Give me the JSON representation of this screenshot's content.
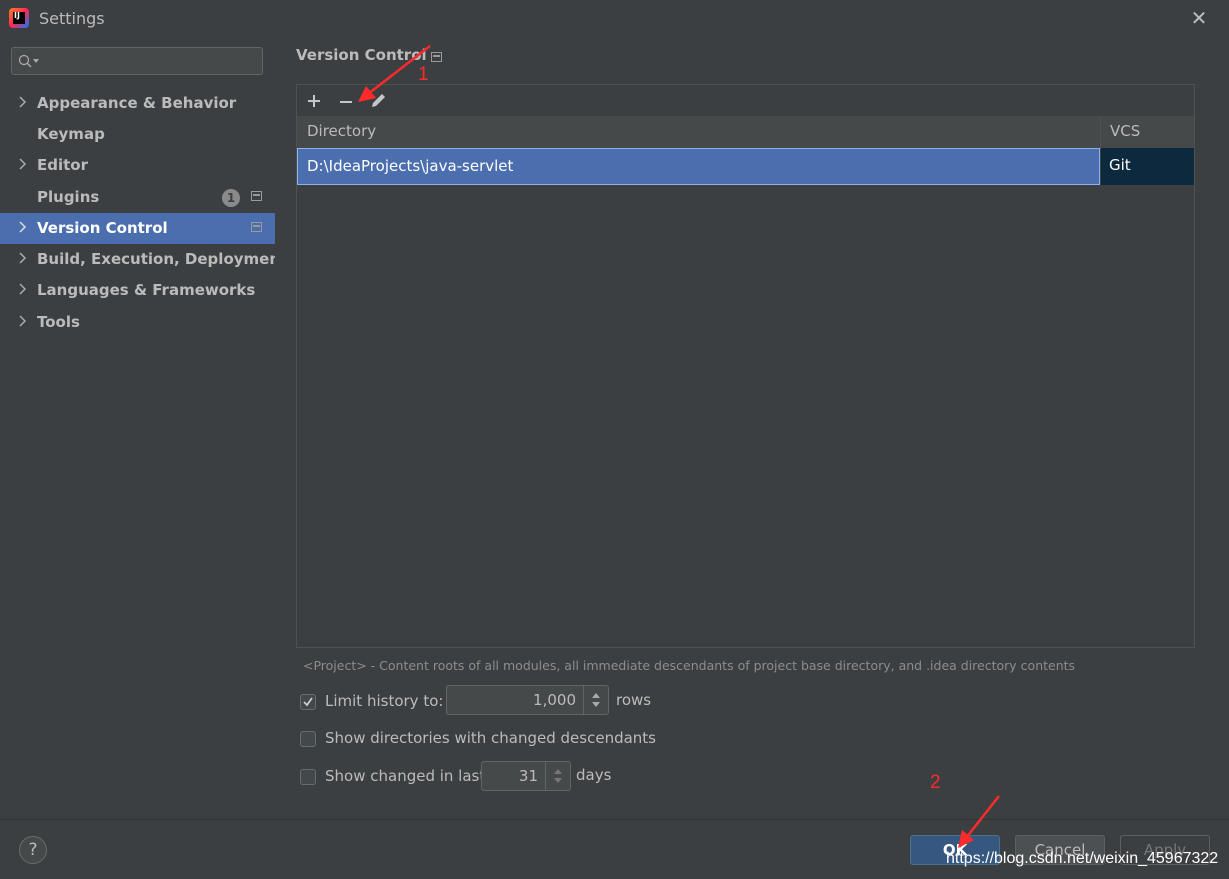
{
  "window": {
    "title": "Settings",
    "app_icon_text": "IJ",
    "close_glyph": "✕"
  },
  "sidebar": {
    "search_placeholder": "",
    "items": [
      {
        "label": "Appearance & Behavior",
        "expandable": true
      },
      {
        "label": "Keymap",
        "expandable": false
      },
      {
        "label": "Editor",
        "expandable": true
      },
      {
        "label": "Plugins",
        "expandable": false,
        "badge": "1"
      },
      {
        "label": "Version Control",
        "expandable": true,
        "selected": true
      },
      {
        "label": "Build, Execution, Deployment",
        "expandable": true
      },
      {
        "label": "Languages & Frameworks",
        "expandable": true
      },
      {
        "label": "Tools",
        "expandable": true
      }
    ]
  },
  "main": {
    "title": "Version Control",
    "table": {
      "columns": [
        "Directory",
        "VCS"
      ],
      "rows": [
        {
          "directory": "D:\\IdeaProjects\\java-servlet",
          "vcs": "Git"
        }
      ]
    },
    "hint": "<Project> - Content roots of all modules, all immediate descendants of project base directory, and .idea directory contents",
    "options": {
      "limit_history": {
        "label": "Limit history to:",
        "checked": true,
        "value": "1,000",
        "unit": "rows"
      },
      "show_dirs": {
        "label": "Show directories with changed descendants",
        "checked": false
      },
      "show_changed": {
        "label": "Show changed in last",
        "checked": false,
        "value": "31",
        "unit": "days"
      }
    }
  },
  "footer": {
    "help": "?",
    "ok": "OK",
    "cancel": "Cancel",
    "apply": "Apply"
  },
  "annotations": {
    "marker1": "1",
    "marker2": "2",
    "color": "#ff2a2a"
  },
  "watermark": "https://blog.csdn.net/weixin_45967322"
}
